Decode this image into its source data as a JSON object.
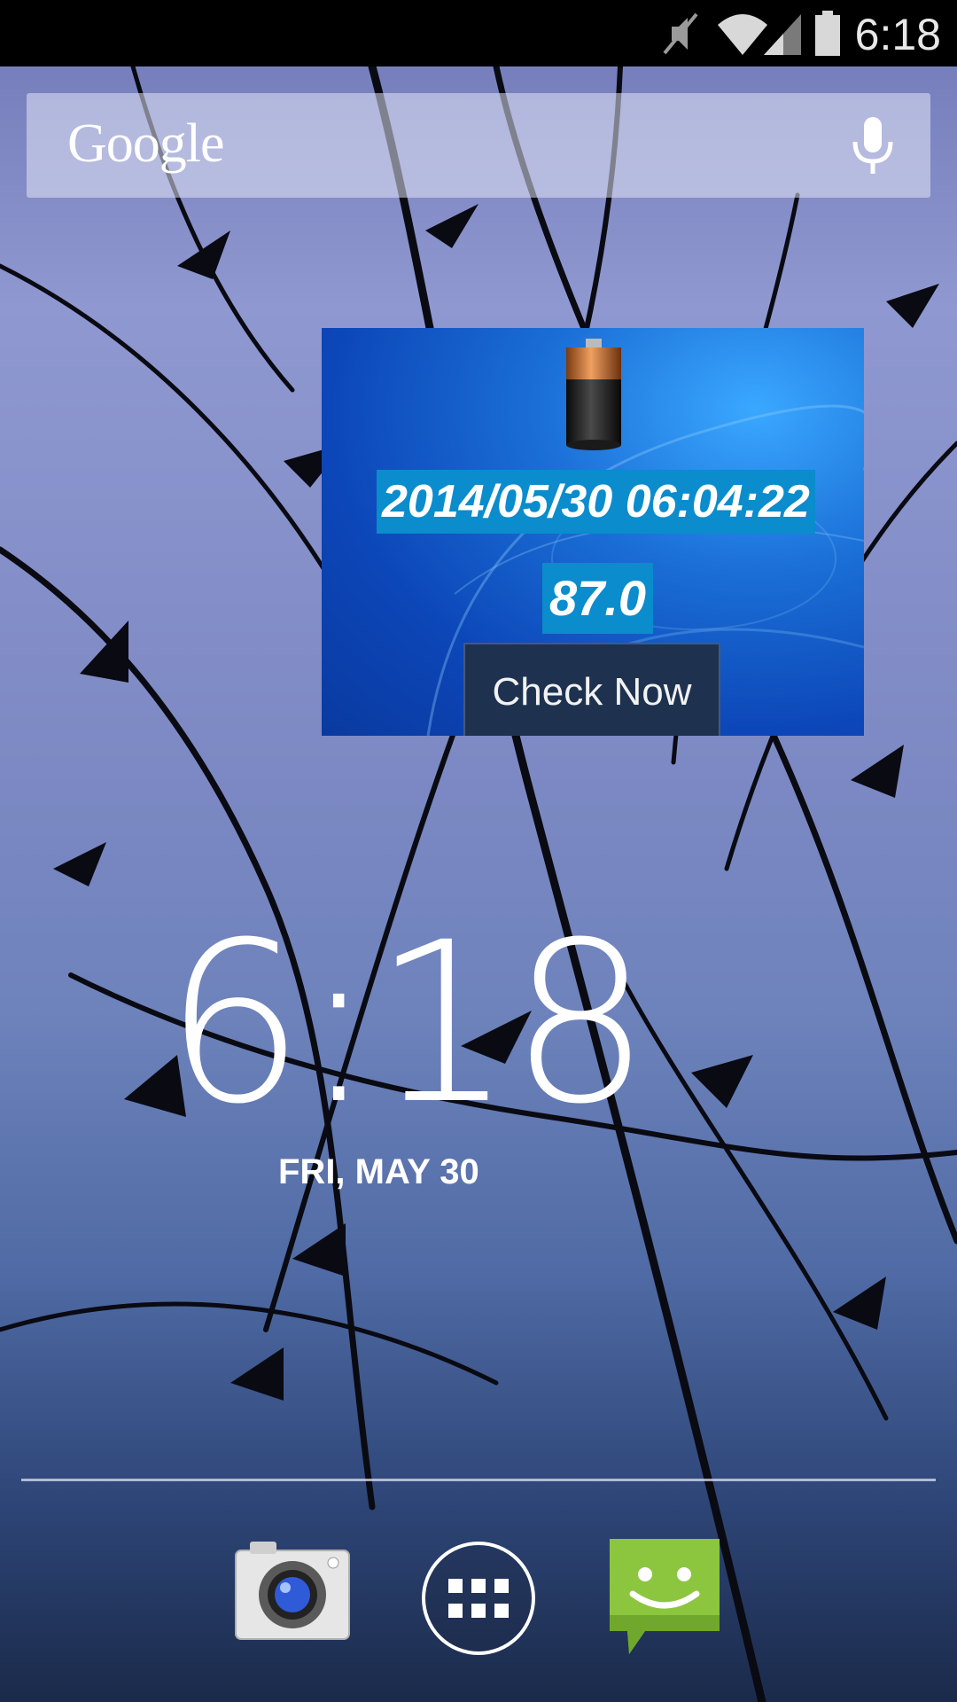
{
  "status_bar": {
    "time": "6:18",
    "icons": [
      "muted-icon",
      "wifi-icon",
      "signal-icon",
      "battery-icon"
    ]
  },
  "search": {
    "logo_text": "Google",
    "icon": "mic-icon"
  },
  "battery_widget": {
    "datetime": "2014/05/30 06:04:22",
    "level": "87.0",
    "button_label": "Check Now",
    "icon": "battery-cell-icon"
  },
  "clock": {
    "time": "6:18",
    "date": "FRI, MAY 30"
  },
  "dock": {
    "items": [
      {
        "name": "camera-app",
        "icon": "camera-icon"
      },
      {
        "name": "app-drawer",
        "icon": "app-drawer-icon"
      },
      {
        "name": "messaging-app",
        "icon": "messaging-icon"
      }
    ]
  },
  "colors": {
    "status_bar_bg": "#000000",
    "widget_highlight": "#0a8ccd",
    "widget_button_bg": "#1e3250",
    "messaging_green": "#8cc63f"
  }
}
